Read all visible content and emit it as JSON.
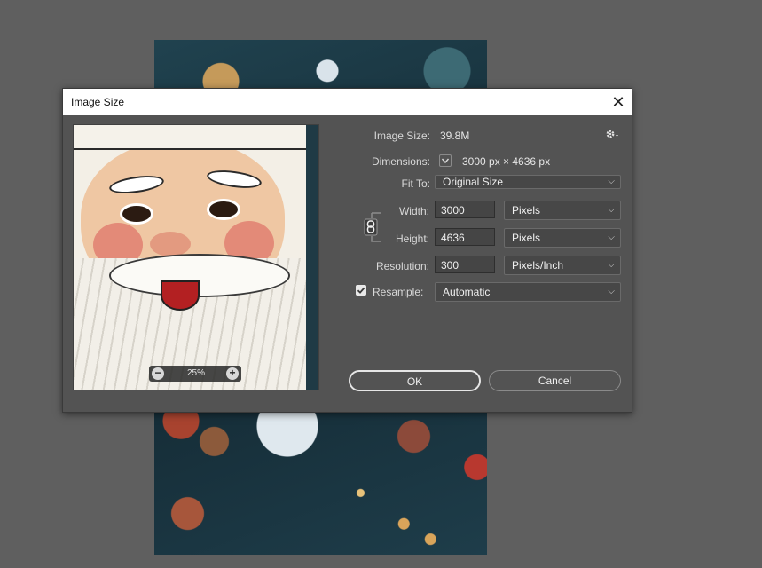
{
  "dialog": {
    "title": "Image Size",
    "close_symbol": "✕"
  },
  "preview": {
    "zoom_level": "25%",
    "zoom_out_symbol": "−",
    "zoom_in_symbol": "+"
  },
  "info": {
    "image_size_label": "Image Size:",
    "image_size_value": "39.8M",
    "dimensions_label": "Dimensions:",
    "dimensions_value": "3000 px  ×  4636 px"
  },
  "fit_to": {
    "label": "Fit To:",
    "value": "Original Size"
  },
  "width": {
    "label": "Width:",
    "value": "3000",
    "unit": "Pixels"
  },
  "height": {
    "label": "Height:",
    "value": "4636",
    "unit": "Pixels"
  },
  "resolution": {
    "label": "Resolution:",
    "value": "300",
    "unit": "Pixels/Inch"
  },
  "resample": {
    "label": "Resample:",
    "checked": true,
    "value": "Automatic"
  },
  "buttons": {
    "ok": "OK",
    "cancel": "Cancel"
  },
  "icons": {
    "gear": "gear-icon",
    "link": "chain-link-icon",
    "chevron": "chevron-down-icon",
    "check": "checkmark-icon"
  }
}
